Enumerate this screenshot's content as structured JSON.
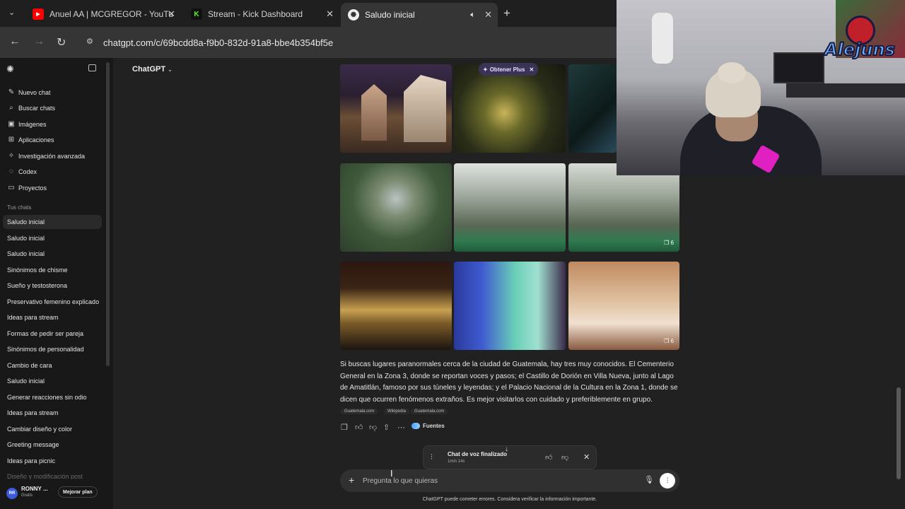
{
  "browser": {
    "tabs": [
      {
        "title": "Anuel AA | MCGREGOR - YouTu",
        "favicon": "youtube-icon"
      },
      {
        "title": "Stream - Kick Dashboard",
        "favicon": "kick-icon"
      },
      {
        "title": "Saludo inicial",
        "favicon": "chatgpt-icon",
        "active": true
      }
    ],
    "url": "chatgpt.com/c/69bcdd8a-f9b0-832d-91a8-bbe4b354bf5e"
  },
  "sidebar": {
    "top_items": [
      {
        "label": "Nuevo chat",
        "icon": "edit-icon"
      },
      {
        "label": "Buscar chats",
        "icon": "search-icon"
      },
      {
        "label": "Imágenes",
        "icon": "image-icon"
      },
      {
        "label": "Aplicaciones",
        "icon": "apps-icon"
      },
      {
        "label": "Investigación avanzada",
        "icon": "research-icon"
      },
      {
        "label": "Codex",
        "icon": "codex-icon"
      },
      {
        "label": "Proyectos",
        "icon": "folder-icon"
      }
    ],
    "section_label": "Tus chats",
    "chats": [
      "Saludo inicial",
      "Saludo inicial",
      "Saludo inicial",
      "Sinónimos de chisme",
      "Sueño y testosterona",
      "Preservativo femenino explicado",
      "Ideas para stream",
      "Formas de pedir ser pareja",
      "Sinónimos de personalidad",
      "Cambio de cara",
      "Saludo inicial",
      "Generar reacciones sin odio",
      "Ideas para stream",
      "Cambiar diseño y color",
      "Greeting message",
      "Ideas para picnic",
      "Diseño y modificación post"
    ],
    "user": {
      "initials": "RR",
      "name": "RONNY ...",
      "plan": "Gratis",
      "upgrade_label": "Mejorar plan"
    }
  },
  "header": {
    "model": "ChatGPT"
  },
  "banner": {
    "label": "Obtener Plus"
  },
  "images": {
    "more_count_row2": "6",
    "more_count_row3": "6"
  },
  "answer": {
    "text": "Si buscas lugares paranormales cerca de la ciudad de Guatemala, hay tres muy conocidos. El Cementerio General en la Zona 3, donde se reportan voces y pasos; el Castillo de Dorión en Villa Nueva, junto al Lago de Amatitlán, famoso por sus túneles y leyendas; y el Palacio Nacional de la Cultura en la Zona 1, donde se dicen que ocurren fenómenos extraños. Es mejor visitarlos con cuidado y preferiblemente en grupo.",
    "sources": [
      "Guatemala.com",
      "Wikipedia",
      "Guatemala.com"
    ],
    "sources_button": "Fuentes"
  },
  "voice": {
    "title": "Chat de voz finalizado",
    "duration": "1min 14s"
  },
  "composer": {
    "placeholder": "Pregunta lo que quieras"
  },
  "disclaimer": "ChatGPT puede cometer errores. Considera verificar la información importante.",
  "overlay": {
    "brand": "Alejuns"
  },
  "colors": {
    "youtube": "#ff0000",
    "kick": "#53fc18",
    "accent_blue": "#4a9eff"
  }
}
